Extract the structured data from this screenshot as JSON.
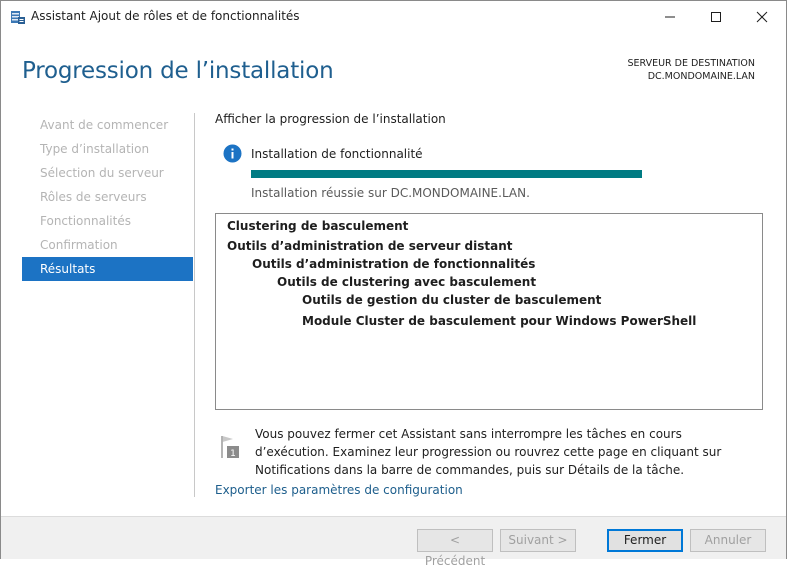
{
  "window": {
    "title": "Assistant Ajout de rôles et de fonctionnalités"
  },
  "header": {
    "page_title": "Progression de l’installation",
    "destination_label": "SERVEUR DE DESTINATION",
    "destination_value": "DC.MONDOMAINE.LAN"
  },
  "nav": {
    "items": [
      {
        "label": "Avant de commencer",
        "active": false
      },
      {
        "label": "Type d’installation",
        "active": false
      },
      {
        "label": "Sélection du serveur",
        "active": false
      },
      {
        "label": "Rôles de serveurs",
        "active": false
      },
      {
        "label": "Fonctionnalités",
        "active": false
      },
      {
        "label": "Confirmation",
        "active": false
      },
      {
        "label": "Résultats",
        "active": true
      }
    ]
  },
  "main": {
    "section_label": "Afficher la progression de l’installation",
    "info_text": "Installation de fonctionnalité",
    "progress_fraction": 1.0,
    "progress_color": "#007b83",
    "status_text": "Installation réussie sur DC.MONDOMAINE.LAN.",
    "results": [
      "Clustering de basculement",
      "Outils d’administration de serveur distant",
      "Outils d’administration de fonctionnalités",
      "Outils de clustering avec basculement",
      "Outils de gestion du cluster de basculement",
      "Module Cluster de basculement pour Windows PowerShell"
    ],
    "notice": "Vous pouvez fermer cet Assistant sans interrompre les tâches en cours d’exécution. Examinez leur progression ou rouvrez cette page en cliquant sur Notifications dans la barre de commandes, puis sur Détails de la tâche.",
    "flag_badge": "1",
    "export_link": "Exporter les paramètres de configuration"
  },
  "footer": {
    "previous_label": "< Précédent",
    "next_label": "Suivant >",
    "close_label": "Fermer",
    "cancel_label": "Annuler"
  },
  "colors": {
    "accent": "#1c73c4",
    "title": "#1f5f8f",
    "link": "#1d5e8c"
  }
}
